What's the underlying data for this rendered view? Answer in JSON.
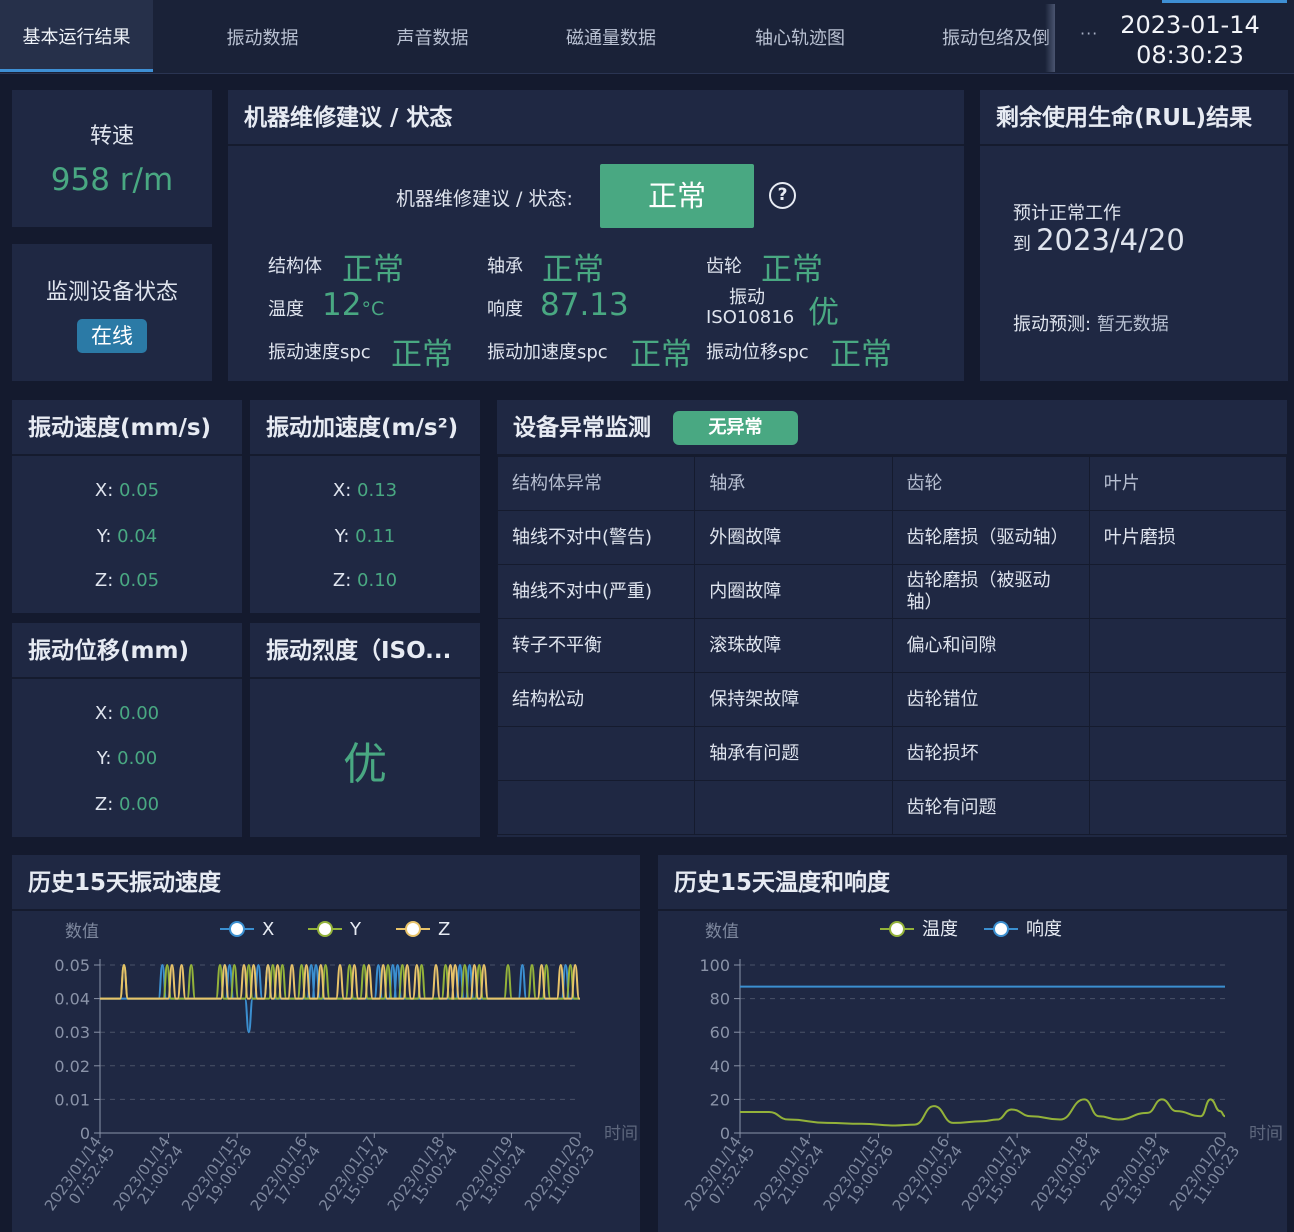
{
  "tabs": [
    {
      "label": "基本运行结果",
      "active": true
    },
    {
      "label": "振动数据"
    },
    {
      "label": "声音数据"
    },
    {
      "label": "磁通量数据"
    },
    {
      "label": "轴心轨迹图"
    },
    {
      "label": "振动包络及倒"
    }
  ],
  "more_label": "···",
  "date": "2023-01-14",
  "time": "08:30:23",
  "speed": {
    "label": "转速",
    "value": "958 r/m"
  },
  "device_status": {
    "label": "监测设备状态",
    "badge": "在线"
  },
  "maintenance": {
    "title": "机器维修建议 / 状态",
    "status_label": "机器维修建议 / 状态:",
    "status_value": "正常",
    "help_icon": "?",
    "items": {
      "structure_label": "结构体",
      "structure_value": "正常",
      "bearing_label": "轴承",
      "bearing_value": "正常",
      "gear_label": "齿轮",
      "gear_value": "正常",
      "temp_label": "温度",
      "temp_value": "12",
      "temp_unit": "°C",
      "loudness_label": "响度",
      "loudness_value": "87.13",
      "iso_label_1": "振动",
      "iso_label_2": "ISO10816",
      "iso_value": "优",
      "vspc_label": "振动速度spc",
      "vspc_value": "正常",
      "aspc_label": "振动加速度spc",
      "aspc_value": "正常",
      "dspc_label": "振动位移spc",
      "dspc_value": "正常"
    }
  },
  "rul": {
    "title": "剩余使用生命(RUL)结果",
    "line1": "预计正常工作",
    "prefix": "到",
    "date": "2023/4/20",
    "forecast_label": "振动预测:",
    "forecast_value": "暂无数据"
  },
  "vib_speed": {
    "title": "振动速度(mm/s)",
    "x": "0.05",
    "y": "0.04",
    "z": "0.05"
  },
  "vib_accel": {
    "title": "振动加速度(m/s²)",
    "x": "0.13",
    "y": "0.11",
    "z": "0.10"
  },
  "vib_disp": {
    "title": "振动位移(mm)",
    "x": "0.00",
    "y": "0.00",
    "z": "0.00"
  },
  "vib_severity": {
    "title": "振动烈度（ISO...",
    "value": "优"
  },
  "axis_keys": {
    "x": "X:",
    "y": "Y:",
    "z": "Z:"
  },
  "anomaly": {
    "title": "设备异常监测",
    "badge": "无异常",
    "headers": [
      "结构体异常",
      "轴承",
      "齿轮",
      "叶片"
    ],
    "rows": [
      [
        "轴线不对中(警告)",
        "外圈故障",
        "齿轮磨损（驱动轴）",
        "叶片磨损"
      ],
      [
        "轴线不对中(严重)",
        "内圈故障",
        "齿轮磨损（被驱动轴）",
        ""
      ],
      [
        "转子不平衡",
        "滚珠故障",
        "偏心和间隙",
        ""
      ],
      [
        "结构松动",
        "保持架故障",
        "齿轮错位",
        ""
      ],
      [
        "",
        "轴承有问题",
        "齿轮损坏",
        ""
      ],
      [
        "",
        "",
        "齿轮有问题",
        ""
      ]
    ]
  },
  "chart_titles": {
    "left": "历史15天振动速度",
    "right": "历史15天温度和响度"
  },
  "chart_data": [
    {
      "type": "line",
      "title": "历史15天振动速度",
      "ylabel": "数值",
      "xlabel": "时间",
      "ylim": [
        0,
        0.05
      ],
      "yticks": [
        "0.05",
        "0.04",
        "0.03",
        "0.02",
        "0.01",
        "0"
      ],
      "grid": true,
      "legend": "top-center",
      "categories": [
        "2023/01/14 07:52:45",
        "2023/01/14 21:00:24",
        "2023/01/15 19:00:26",
        "2023/01/16 17:00:24",
        "2023/01/17 15:00:24",
        "2023/01/18 15:00:24",
        "2023/01/19 13:00:24",
        "2023/01/20 11:00:23"
      ],
      "series": [
        {
          "name": "X",
          "color": "#3b8fd0",
          "baseline": 0.04,
          "spikes_up": [
            0.13,
            0.26,
            0.27,
            0.33,
            0.35,
            0.44,
            0.45,
            0.58,
            0.61,
            0.62,
            0.75,
            0.77,
            0.88,
            0.97
          ],
          "spikes_down": [
            0.31
          ]
        },
        {
          "name": "Y",
          "color": "#93b23a",
          "baseline": 0.04,
          "spikes_up": [
            0.05,
            0.14,
            0.19,
            0.25,
            0.28,
            0.31,
            0.36,
            0.38,
            0.42,
            0.47,
            0.52,
            0.55,
            0.6,
            0.63,
            0.67,
            0.72,
            0.76,
            0.79,
            0.85,
            0.9,
            0.93,
            0.98
          ]
        },
        {
          "name": "Z",
          "color": "#e8c36a",
          "baseline": 0.04,
          "spikes_up": [
            0.05,
            0.15,
            0.17,
            0.26,
            0.3,
            0.32,
            0.35,
            0.37,
            0.4,
            0.43,
            0.46,
            0.5,
            0.53,
            0.56,
            0.59,
            0.64,
            0.66,
            0.7,
            0.73,
            0.74,
            0.78,
            0.8,
            0.92,
            0.96,
            0.99
          ]
        }
      ]
    },
    {
      "type": "line",
      "title": "历史15天温度和响度",
      "ylabel": "数值",
      "xlabel": "时间",
      "ylim": [
        0,
        100
      ],
      "yticks": [
        "100",
        "80",
        "60",
        "40",
        "20",
        "0"
      ],
      "grid": true,
      "legend": "top-center",
      "categories": [
        "2023/01/14 07:52:45",
        "2023/01/14 21:00:24",
        "2023/01/15 19:00:26",
        "2023/01/16 17:00:24",
        "2023/01/17 15:00:24",
        "2023/01/18 15:00:24",
        "2023/01/19 13:00:24",
        "2023/01/20 11:00:23"
      ],
      "series": [
        {
          "name": "温度",
          "color": "#93b23a",
          "points": [
            [
              0,
              12.5
            ],
            [
              0.06,
              12.5
            ],
            [
              0.1,
              8
            ],
            [
              0.18,
              6
            ],
            [
              0.25,
              5.5
            ],
            [
              0.32,
              4.5
            ],
            [
              0.36,
              5
            ],
            [
              0.4,
              16
            ],
            [
              0.44,
              6
            ],
            [
              0.5,
              7
            ],
            [
              0.53,
              8
            ],
            [
              0.56,
              14
            ],
            [
              0.6,
              10
            ],
            [
              0.66,
              8
            ],
            [
              0.71,
              20
            ],
            [
              0.74,
              10
            ],
            [
              0.78,
              8
            ],
            [
              0.84,
              12
            ],
            [
              0.87,
              20
            ],
            [
              0.9,
              13
            ],
            [
              0.95,
              10
            ],
            [
              0.97,
              20
            ],
            [
              0.99,
              13
            ],
            [
              1.0,
              10
            ]
          ]
        },
        {
          "name": "响度",
          "color": "#3b8fd0",
          "points": [
            [
              0,
              87.13
            ],
            [
              1,
              87.13
            ]
          ]
        }
      ]
    }
  ]
}
